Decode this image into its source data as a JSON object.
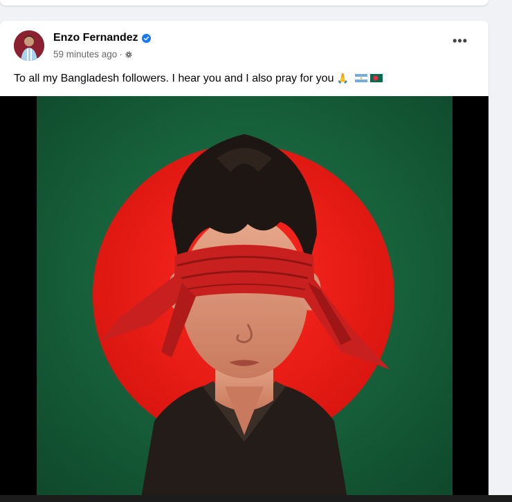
{
  "post": {
    "author_name": "Enzo Fernandez",
    "timestamp": "59 minutes ago",
    "separator": "·",
    "audience_icon": "gear-icon",
    "more_label": "•••",
    "caption_text": "To all my Bangladesh followers. I hear you and I also pray for you",
    "caption_emojis": [
      "praying-hands-emoji",
      "argentina-flag-emoji",
      "bangladesh-flag-emoji"
    ]
  },
  "colors": {
    "verified_badge": "#1877f2",
    "flag_green": "#1b6e43",
    "flag_red": "#e4131b",
    "blindfold_red": "#c8201f"
  }
}
